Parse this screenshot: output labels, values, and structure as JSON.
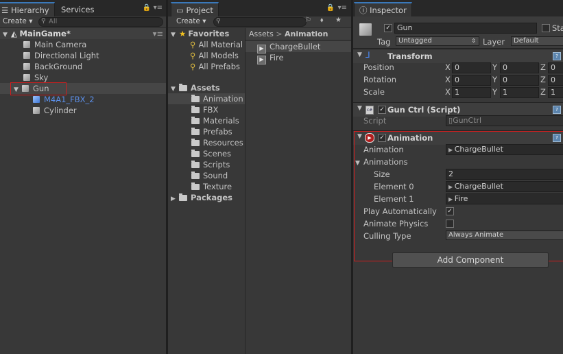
{
  "hierarchy": {
    "tabs": [
      "Hierarchy",
      "Services"
    ],
    "create_label": "Create",
    "search_placeholder": "All",
    "scene": "MainGame*",
    "items": [
      "Main Camera",
      "Directional Light",
      "BackGround",
      "Sky",
      "Gun"
    ],
    "children": [
      "M4A1_FBX_2",
      "Cylinder"
    ]
  },
  "project": {
    "tab": "Project",
    "create_label": "Create",
    "favorites_label": "Favorites",
    "favorites": [
      "All Material",
      "All Models",
      "All Prefabs"
    ],
    "assets_label": "Assets",
    "folders": [
      "Animation",
      "FBX",
      "Materials",
      "Prefabs",
      "Resources",
      "Scenes",
      "Scripts",
      "Sound",
      "Texture"
    ],
    "packages_label": "Packages",
    "breadcrumb": {
      "root": "Assets",
      "separator": ">",
      "current": "Animation"
    },
    "files": [
      "ChargeBullet",
      "Fire"
    ]
  },
  "inspector": {
    "tab": "Inspector",
    "object_name": "Gun",
    "static_label": "Sta",
    "tag_label": "Tag",
    "tag_value": "Untagged",
    "layer_label": "Layer",
    "layer_value": "Default",
    "transform": {
      "title": "Transform",
      "rows": [
        {
          "label": "Position",
          "x": "0",
          "y": "0",
          "z": "0"
        },
        {
          "label": "Rotation",
          "x": "0",
          "y": "0",
          "z": "0"
        },
        {
          "label": "Scale",
          "x": "1",
          "y": "1",
          "z": "1"
        }
      ],
      "axis_x": "X",
      "axis_y": "Y",
      "axis_z": "Z"
    },
    "gun_ctrl": {
      "title": "Gun Ctrl (Script)",
      "script_label": "Script",
      "script_value": "GunCtrl"
    },
    "animation": {
      "title": "Animation",
      "animation_label": "Animation",
      "animation_value": "ChargeBullet",
      "animations_label": "Animations",
      "size_label": "Size",
      "size_value": "2",
      "element0_label": "Element 0",
      "element0_value": "ChargeBullet",
      "element1_label": "Element 1",
      "element1_value": "Fire",
      "play_auto_label": "Play Automatically",
      "animate_physics_label": "Animate Physics",
      "culling_label": "Culling Type",
      "culling_value": "Always Animate"
    },
    "add_component": "Add Component"
  }
}
